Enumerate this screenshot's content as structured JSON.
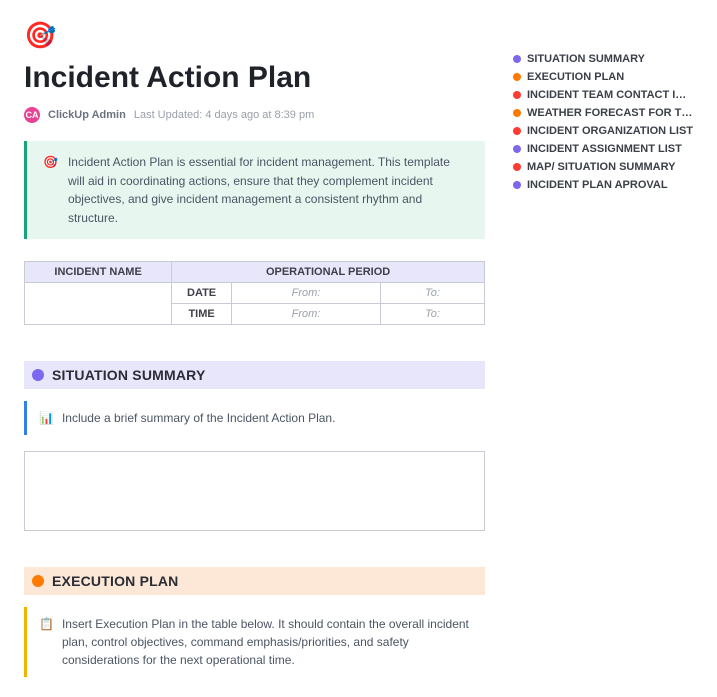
{
  "logo_icon": "🎯",
  "title": "Incident Action Plan",
  "author_initials": "CA",
  "author": "ClickUp Admin",
  "last_updated": "Last Updated: 4 days ago at 8:39 pm",
  "intro_emoji": "🎯",
  "intro_text": "Incident Action Plan is essential for incident management. This template will aid in coordinating actions, ensure that they complement incident objectives, and give incident management a consistent rhythm and structure.",
  "table": {
    "col1": "INCIDENT NAME",
    "col2": "OPERATIONAL PERIOD",
    "date_label": "DATE",
    "time_label": "TIME",
    "from": "From:",
    "to": "To:"
  },
  "sections": {
    "situation": {
      "heading": "SITUATION SUMMARY",
      "note_emoji": "📊",
      "note_text": "Include a brief summary of the Incident Action Plan."
    },
    "execution": {
      "heading": "EXECUTION PLAN",
      "note_emoji": "📋",
      "note_text": "Insert Execution Plan in the table below. It should contain the overall incident plan, control objectives, command emphasis/priorities, and safety considerations for the next operational time."
    }
  },
  "toc": [
    {
      "label": "SITUATION SUMMARY",
      "color": "#7b68ee"
    },
    {
      "label": "EXECUTION PLAN",
      "color": "#ff7a00"
    },
    {
      "label": "INCIDENT TEAM CONTACT INFOR...",
      "color": "#ff3b30"
    },
    {
      "label": "WEATHER FORECAST FOR THE OPE...",
      "color": "#ff7a00"
    },
    {
      "label": "INCIDENT ORGANIZATION LIST",
      "color": "#ff3b30"
    },
    {
      "label": "INCIDENT ASSIGNMENT LIST",
      "color": "#7b68ee"
    },
    {
      "label": "MAP/ SITUATION SUMMARY",
      "color": "#ff3b30"
    },
    {
      "label": "INCIDENT PLAN APROVAL",
      "color": "#7b68ee"
    }
  ]
}
